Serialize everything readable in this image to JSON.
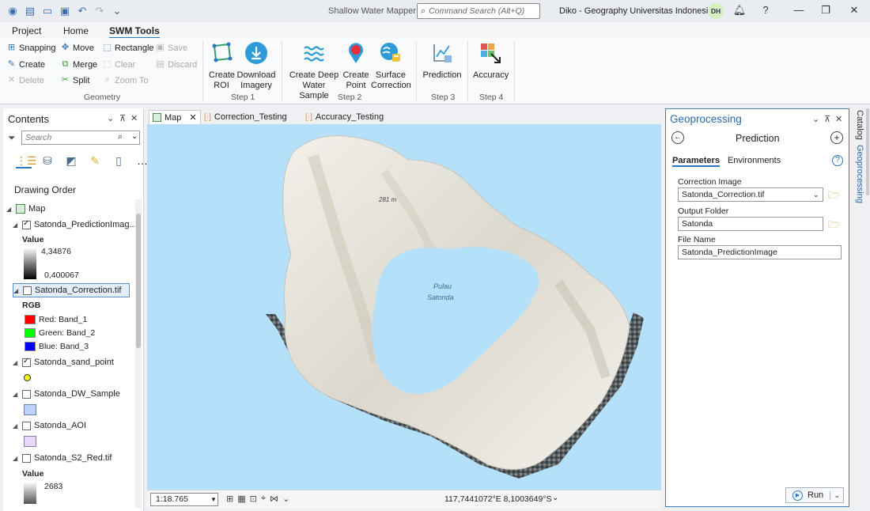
{
  "app": {
    "title": "Shallow Water Mapper",
    "search_placeholder": "Command Search (Alt+Q)",
    "user": "Diko - Geography Universitas Indonesia",
    "user_initials": "DH"
  },
  "ribbon_tabs": [
    "Project",
    "Home",
    "SWM Tools"
  ],
  "ribbon": {
    "geometry": {
      "label": "Geometry",
      "items": [
        "Snapping",
        "Move",
        "Rectangle",
        "Save",
        "Create",
        "Merge",
        "Clear",
        "Discard",
        "Delete",
        "Split",
        "Zoom To"
      ]
    },
    "step1": {
      "label": "Step 1",
      "buttons": [
        "Create ROI",
        "Download Imagery"
      ]
    },
    "step2": {
      "label": "Step 2",
      "buttons": [
        "Create Deep Water Sample",
        "Create Point",
        "Surface Correction"
      ]
    },
    "step3": {
      "label": "Step 3",
      "buttons": [
        "Prediction"
      ]
    },
    "step4": {
      "label": "Step 4",
      "buttons": [
        "Accuracy"
      ]
    }
  },
  "contents": {
    "title": "Contents",
    "search_placeholder": "Search",
    "drawing_order": "Drawing Order",
    "map_label": "Map",
    "layers": [
      {
        "name": "Satonda_PredictionImag...",
        "checked": true,
        "legend_title": "Value",
        "max": "4,34876",
        "min": "0,400067"
      },
      {
        "name": "Satonda_Correction.tif",
        "checked": false,
        "legend_title": "RGB",
        "bands": [
          "Red:   Band_1",
          "Green: Band_2",
          "Blue:  Band_3"
        ]
      },
      {
        "name": "Satonda_sand_point",
        "checked": true
      },
      {
        "name": "Satonda_DW_Sample",
        "checked": false
      },
      {
        "name": "Satonda_AOI",
        "checked": false
      },
      {
        "name": "Satonda_S2_Red.tif",
        "checked": false,
        "legend_title": "Value",
        "max": "2683"
      }
    ]
  },
  "map_tabs": [
    "Map",
    "Correction_Testing",
    "Accuracy_Testing"
  ],
  "map": {
    "peak_label": "281 m",
    "lake_label_1": "Pulau",
    "lake_label_2": "Satonda",
    "scale": "1:18.765",
    "coords": "117,7441072°E 8,1003649°S"
  },
  "geoprocessing": {
    "title": "Geoprocessing",
    "tool": "Prediction",
    "tabs": [
      "Parameters",
      "Environments"
    ],
    "fields": [
      {
        "label": "Correction Image",
        "value": "Satonda_Correction.tif"
      },
      {
        "label": "Output Folder",
        "value": "Satonda"
      },
      {
        "label": "File Name",
        "value": "Satonda_PredictionImage"
      }
    ],
    "run_label": "Run"
  },
  "side_tabs": [
    "Catalog",
    "Geoprocessing"
  ]
}
